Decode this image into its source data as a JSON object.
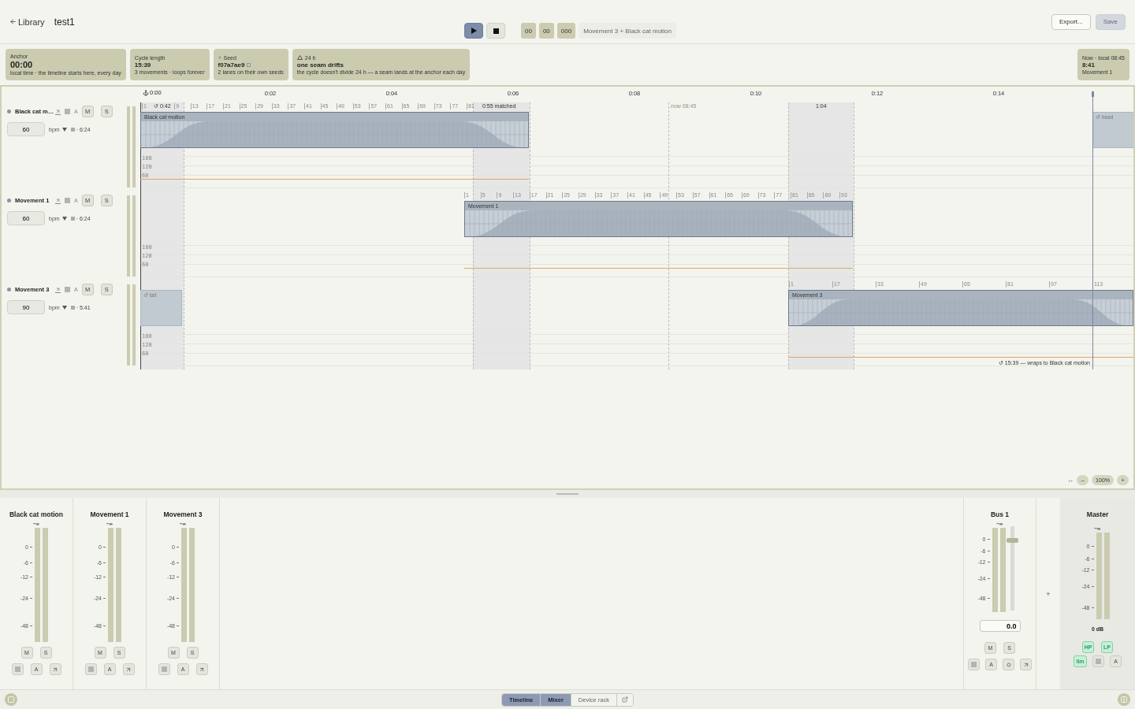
{
  "header": {
    "back_label": "Library",
    "title": "test1"
  },
  "transport": {
    "playing": true,
    "time_fields": [
      "00",
      "00",
      "000"
    ],
    "now_playing": "Movement 3 + Black cat motion"
  },
  "actions": [
    {
      "label": "Export...",
      "disabled": false
    },
    {
      "label": "Save",
      "disabled": true
    }
  ],
  "info_cards": [
    {
      "kind": "plain",
      "label": "Anchor",
      "value": "00:00",
      "note": "local time · the timeline starts here, every day"
    },
    {
      "kind": "plain",
      "label": "Cycle length",
      "value": "15:39",
      "note": "3 movements · loops forever"
    },
    {
      "kind": "seed",
      "label": "Seed",
      "value": "f07a7ae9",
      "note": "2 lanes on their own seeds"
    },
    {
      "kind": "warning",
      "label": "24 h",
      "value": "one seam drifts",
      "note": "the cycle doesn't divide 24 h — a seam lands at the anchor each day"
    }
  ],
  "now_card": {
    "label": "Now · local 08:45",
    "value": "8:41",
    "note": "Movement 1"
  },
  "timeline": {
    "time_ticks": [
      "0:00",
      "0:02",
      "0:04",
      "0:06",
      "0:08",
      "0:10",
      "0:12",
      "0:14"
    ],
    "markers": [
      {
        "kind": "loop",
        "label": "↺ 0:42"
      },
      {
        "kind": "match",
        "label": "0:55 matched"
      },
      {
        "kind": "now",
        "label": "now 08:45"
      },
      {
        "kind": "seam",
        "label": "1:04"
      }
    ],
    "tracks": [
      {
        "name": "Black cat m…",
        "bpm": "60",
        "unit": "bpm",
        "length": "· 6:24",
        "mute": {
          "label": "M",
          "on": false
        },
        "solo": {
          "label": "S",
          "on": false
        },
        "auto_label": "A",
        "clip_label": "Black cat motion",
        "tempo_labels": [
          "180",
          "120",
          "60"
        ],
        "bars": [
          "1",
          "9",
          "13",
          "17",
          "21",
          "25",
          "29",
          "33",
          "37",
          "41",
          "45",
          "49",
          "53",
          "57",
          "61",
          "65",
          "69",
          "73",
          "77",
          "81"
        ]
      },
      {
        "name": "Movement 1",
        "bpm": "60",
        "unit": "bpm",
        "length": "· 6:24",
        "mute": {
          "label": "M",
          "on": false
        },
        "solo": {
          "label": "S",
          "on": false
        },
        "auto_label": "A",
        "clip_label": "Movement 1",
        "tempo_labels": [
          "180",
          "120",
          "60"
        ],
        "bars": [
          "1",
          "5",
          "9",
          "13",
          "17",
          "21",
          "25",
          "29",
          "33",
          "37",
          "41",
          "45",
          "49",
          "53",
          "57",
          "61",
          "65",
          "69",
          "73",
          "77",
          "81",
          "85",
          "89",
          "93"
        ]
      },
      {
        "name": "Movement 3",
        "bpm": "90",
        "unit": "bpm",
        "length": "· 5:41",
        "mute": {
          "label": "M",
          "on": false
        },
        "solo": {
          "label": "S",
          "on": false
        },
        "auto_label": "A",
        "clip_label": "Movement 3",
        "tempo_labels": [
          "180",
          "120",
          "60"
        ],
        "bars": [
          "1",
          "17",
          "33",
          "49",
          "65",
          "81",
          "97",
          "113"
        ]
      }
    ],
    "ghosts": [
      {
        "label": "↺ head"
      },
      {
        "label": "↺ tail"
      }
    ],
    "wrap_note": "↺ 15:39 — wraps to Black cat motion",
    "zoom": {
      "fit": "↔",
      "minus": "–",
      "label": "100%",
      "plus": "+"
    }
  },
  "mixer": {
    "channels": [
      {
        "name": "Black cat motion",
        "peak": "−∞",
        "scale": [
          "0",
          "-6",
          "-12",
          "-24",
          "-48"
        ],
        "mute": {
          "label": "M",
          "on": false
        },
        "solo": {
          "label": "S",
          "on": false
        },
        "auto_label": "A"
      },
      {
        "name": "Movement 1",
        "peak": "−∞",
        "scale": [
          "0",
          "-6",
          "-12",
          "-24",
          "-48"
        ],
        "mute": {
          "label": "M",
          "on": false
        },
        "solo": {
          "label": "S",
          "on": false
        },
        "auto_label": "A"
      },
      {
        "name": "Movement 3",
        "peak": "−∞",
        "scale": [
          "0",
          "-6",
          "-12",
          "-24",
          "-48"
        ],
        "mute": {
          "label": "M",
          "on": false
        },
        "solo": {
          "label": "S",
          "on": false
        },
        "auto_label": "A"
      }
    ],
    "bus": {
      "name": "Bus 1",
      "peak": "−∞",
      "scale": [
        "0",
        "-6",
        "-12",
        "-24",
        "-48"
      ],
      "fader": {
        "level": 0.85
      },
      "gain": "0.0",
      "mute": {
        "label": "M",
        "on": false
      },
      "solo": {
        "label": "S",
        "on": false
      },
      "auto_label": "A"
    },
    "add_label": "+",
    "master": {
      "name": "Master",
      "peak": "−∞",
      "scale": [
        "0",
        "-6",
        "-12",
        "-24",
        "-48"
      ],
      "gain": "0 dB",
      "filters": [
        {
          "label": "HP",
          "on": true
        },
        {
          "label": "LP",
          "on": true
        }
      ],
      "limiter": {
        "label": "lim",
        "on": true
      },
      "auto_label": "A"
    }
  },
  "footer": {
    "tabs": [
      {
        "label": "Timeline",
        "selected": true
      },
      {
        "label": "Mixer",
        "selected": true
      },
      {
        "label": "Device rack",
        "selected": false
      }
    ]
  }
}
